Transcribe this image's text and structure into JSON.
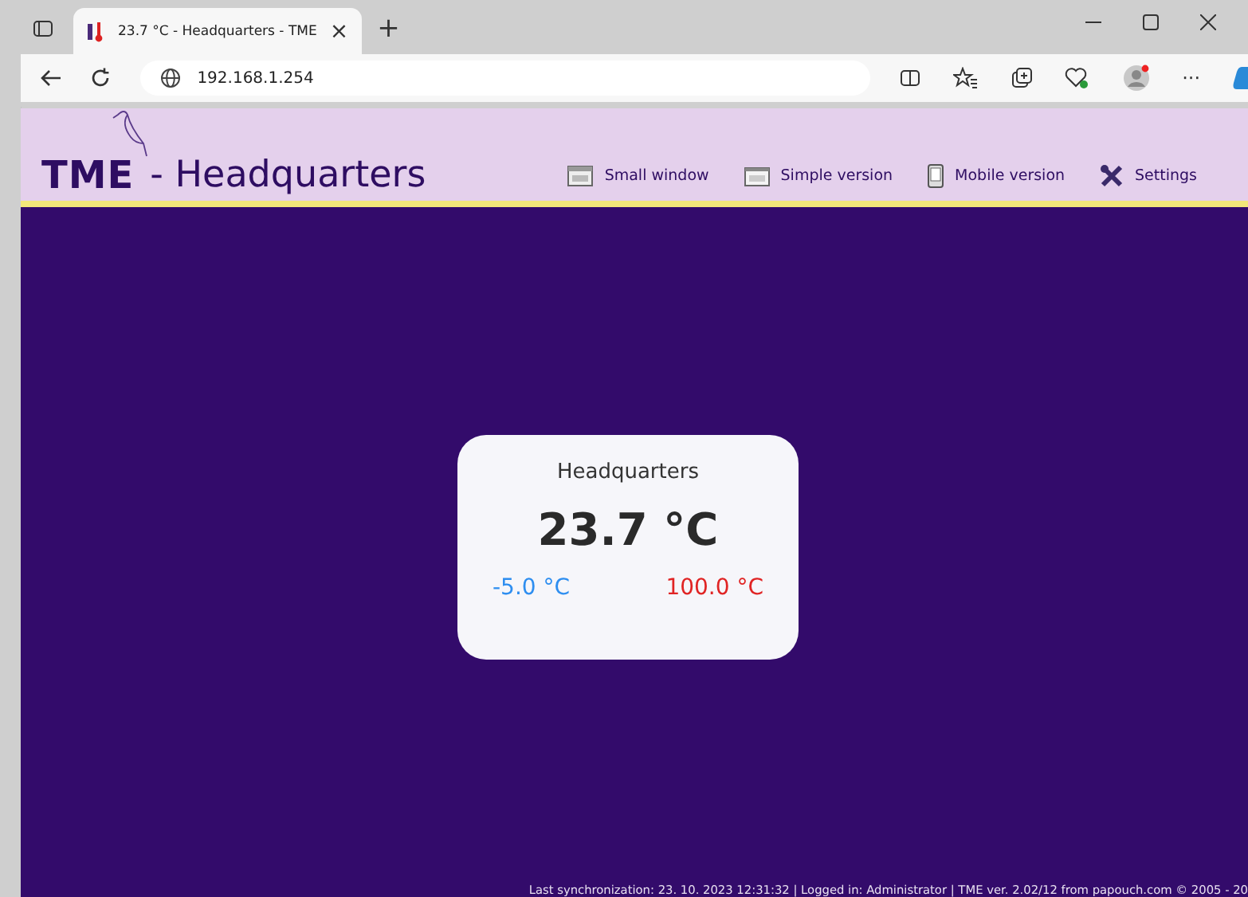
{
  "browser": {
    "tab_title": "23.7 °C - Headquarters - TME",
    "tab_close": "×",
    "new_tab": "+",
    "address": "192.168.1.254",
    "more": "···"
  },
  "header": {
    "logo": "TME",
    "title": "- Headquarters",
    "links": [
      {
        "kind": "window",
        "label": "Small window"
      },
      {
        "kind": "simple",
        "label": "Simple version"
      },
      {
        "kind": "mobile",
        "label": "Mobile version"
      },
      {
        "kind": "settings",
        "label": "Settings"
      }
    ]
  },
  "sensor": {
    "name": "Headquarters",
    "value": "23.7 °C",
    "min": "-5.0 °C",
    "max": "100.0 °C"
  },
  "status_bar": "Last synchronization: 23. 10. 2023 12:31:32 | Logged in: Administrator | TME ver. 2.02/12 from papouch.com © 2005 - 20"
}
